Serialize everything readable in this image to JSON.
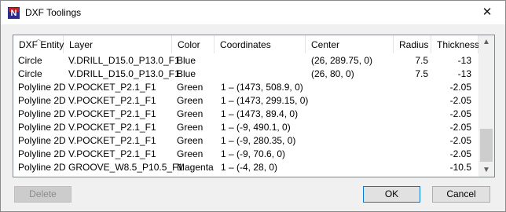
{
  "window": {
    "title": "DXF Toolings",
    "close_glyph": "✕",
    "icon_glyph": "N"
  },
  "table": {
    "columns": [
      "DXF Entity",
      "Layer",
      "Color",
      "Coordinates",
      "Center",
      "Radius",
      "Thickness"
    ],
    "rows": [
      [
        "Circle",
        "V.DRILL_D15.0_P13.0_F1",
        "Blue",
        "",
        "(26, 289.75, 0)",
        "7.5",
        "-13"
      ],
      [
        "Circle",
        "V.DRILL_D15.0_P13.0_F1",
        "Blue",
        "",
        "(26, 80, 0)",
        "7.5",
        "-13"
      ],
      [
        "Polyline 2D",
        "V.POCKET_P2.1_F1",
        "Green",
        "1 – (1473, 508.9, 0)",
        "",
        "",
        "-2.05"
      ],
      [
        "Polyline 2D",
        "V.POCKET_P2.1_F1",
        "Green",
        "1 – (1473, 299.15, 0)",
        "",
        "",
        "-2.05"
      ],
      [
        "Polyline 2D",
        "V.POCKET_P2.1_F1",
        "Green",
        "1 – (1473, 89.4, 0)",
        "",
        "",
        "-2.05"
      ],
      [
        "Polyline 2D",
        "V.POCKET_P2.1_F1",
        "Green",
        "1 – (-9, 490.1, 0)",
        "",
        "",
        "-2.05"
      ],
      [
        "Polyline 2D",
        "V.POCKET_P2.1_F1",
        "Green",
        "1 – (-9, 280.35, 0)",
        "",
        "",
        "-2.05"
      ],
      [
        "Polyline 2D",
        "V.POCKET_P2.1_F1",
        "Green",
        "1 – (-9, 70.6, 0)",
        "",
        "",
        "-2.05"
      ],
      [
        "Polyline 2D",
        "GROOVE_W8.5_P10.5_F1",
        "Magenta",
        "1 – (-4, 28, 0)",
        "",
        "",
        "-10.5"
      ]
    ]
  },
  "scrollbar": {
    "up_glyph": "▲",
    "down_glyph": "▼"
  },
  "buttons": {
    "delete": "Delete",
    "ok": "OK",
    "cancel": "Cancel"
  },
  "colors": {
    "title_bg": "#ffffff",
    "dialog_bg": "#f0f0f0",
    "default_button_border": "#0078d7",
    "icon_blue": "#2b2b8f",
    "icon_red": "#c41f1f"
  }
}
